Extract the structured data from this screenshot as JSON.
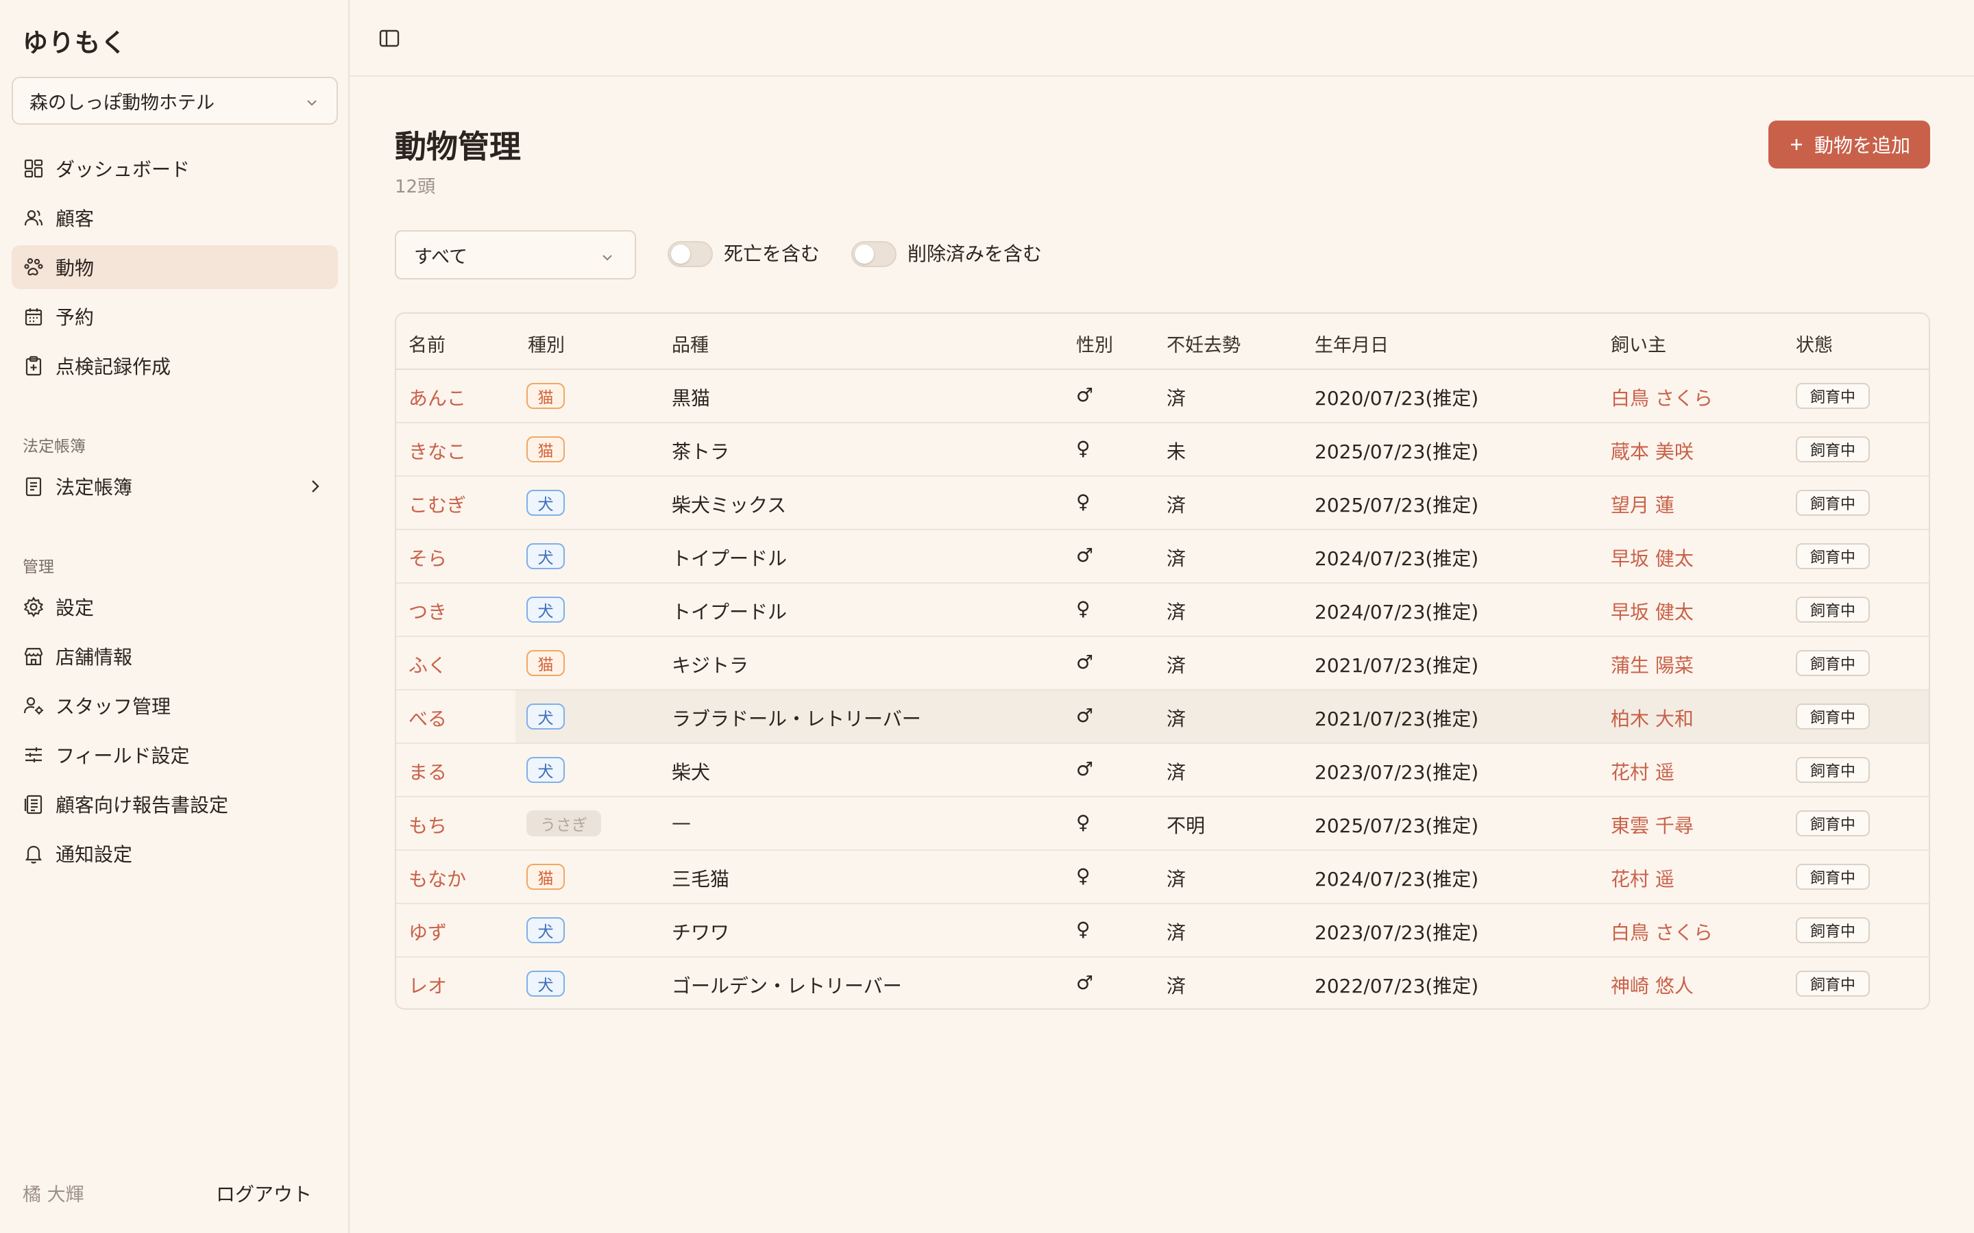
{
  "sidebar": {
    "brand": "ゆりもく",
    "store": "森のしっぽ動物ホテル",
    "nav": [
      {
        "label": "ダッシュボード",
        "icon": "dashboard-icon"
      },
      {
        "label": "顧客",
        "icon": "users-icon"
      },
      {
        "label": "動物",
        "icon": "paw-icon",
        "active": true
      },
      {
        "label": "予約",
        "icon": "calendar-icon"
      },
      {
        "label": "点検記録作成",
        "icon": "clipboard-plus-icon"
      }
    ],
    "section_legal": "法定帳簿",
    "legal_item": "法定帳簿",
    "section_admin": "管理",
    "admin": [
      {
        "label": "設定",
        "icon": "gear-icon"
      },
      {
        "label": "店舗情報",
        "icon": "store-icon"
      },
      {
        "label": "スタッフ管理",
        "icon": "user-cog-icon"
      },
      {
        "label": "フィールド設定",
        "icon": "sliders-icon"
      },
      {
        "label": "顧客向け報告書設定",
        "icon": "report-icon"
      },
      {
        "label": "通知設定",
        "icon": "bell-icon"
      }
    ],
    "user": "橘 大輝",
    "logout": "ログアウト"
  },
  "page": {
    "title": "動物管理",
    "count": "12頭",
    "add_button": "動物を追加"
  },
  "filters": {
    "species_select": "すべて",
    "toggle_deceased": "死亡を含む",
    "toggle_deleted": "削除済みを含む"
  },
  "table": {
    "headers": [
      "名前",
      "種別",
      "品種",
      "性別",
      "不妊去勢",
      "生年月日",
      "飼い主",
      "状態"
    ],
    "rows": [
      {
        "name": "あんこ",
        "species": "猫",
        "breed": "黒猫",
        "sex": "♂",
        "neutered": "済",
        "birth": "2020/07/23(推定)",
        "owner": "白鳥 さくら",
        "status": "飼育中"
      },
      {
        "name": "きなこ",
        "species": "猫",
        "breed": "茶トラ",
        "sex": "♀",
        "neutered": "未",
        "birth": "2025/07/23(推定)",
        "owner": "蔵本 美咲",
        "status": "飼育中"
      },
      {
        "name": "こむぎ",
        "species": "犬",
        "breed": "柴犬ミックス",
        "sex": "♀",
        "neutered": "済",
        "birth": "2025/07/23(推定)",
        "owner": "望月 蓮",
        "status": "飼育中"
      },
      {
        "name": "そら",
        "species": "犬",
        "breed": "トイプードル",
        "sex": "♂",
        "neutered": "済",
        "birth": "2024/07/23(推定)",
        "owner": "早坂 健太",
        "status": "飼育中"
      },
      {
        "name": "つき",
        "species": "犬",
        "breed": "トイプードル",
        "sex": "♀",
        "neutered": "済",
        "birth": "2024/07/23(推定)",
        "owner": "早坂 健太",
        "status": "飼育中"
      },
      {
        "name": "ふく",
        "species": "猫",
        "breed": "キジトラ",
        "sex": "♂",
        "neutered": "済",
        "birth": "2021/07/23(推定)",
        "owner": "蒲生 陽菜",
        "status": "飼育中"
      },
      {
        "name": "べる",
        "species": "犬",
        "breed": "ラブラドール・レトリーバー",
        "sex": "♂",
        "neutered": "済",
        "birth": "2021/07/23(推定)",
        "owner": "柏木 大和",
        "status": "飼育中"
      },
      {
        "name": "まる",
        "species": "犬",
        "breed": "柴犬",
        "sex": "♂",
        "neutered": "済",
        "birth": "2023/07/23(推定)",
        "owner": "花村 遥",
        "status": "飼育中"
      },
      {
        "name": "もち",
        "species": "うさぎ",
        "breed": "—",
        "sex": "♀",
        "neutered": "不明",
        "birth": "2025/07/23(推定)",
        "owner": "東雲 千尋",
        "status": "飼育中"
      },
      {
        "name": "もなか",
        "species": "猫",
        "breed": "三毛猫",
        "sex": "♀",
        "neutered": "済",
        "birth": "2024/07/23(推定)",
        "owner": "花村 遥",
        "status": "飼育中"
      },
      {
        "name": "ゆず",
        "species": "犬",
        "breed": "チワワ",
        "sex": "♀",
        "neutered": "済",
        "birth": "2023/07/23(推定)",
        "owner": "白鳥 さくら",
        "status": "飼育中"
      },
      {
        "name": "レオ",
        "species": "犬",
        "breed": "ゴールデン・レトリーバー",
        "sex": "♂",
        "neutered": "済",
        "birth": "2022/07/23(推定)",
        "owner": "神崎 悠人",
        "status": "飼育中"
      }
    ]
  },
  "colors": {
    "accent": "#c9614a",
    "background": "#fcf5ed",
    "active_nav": "#f5e4d8",
    "cat_badge": "#f0a766",
    "dog_badge": "#7fb0e8"
  }
}
